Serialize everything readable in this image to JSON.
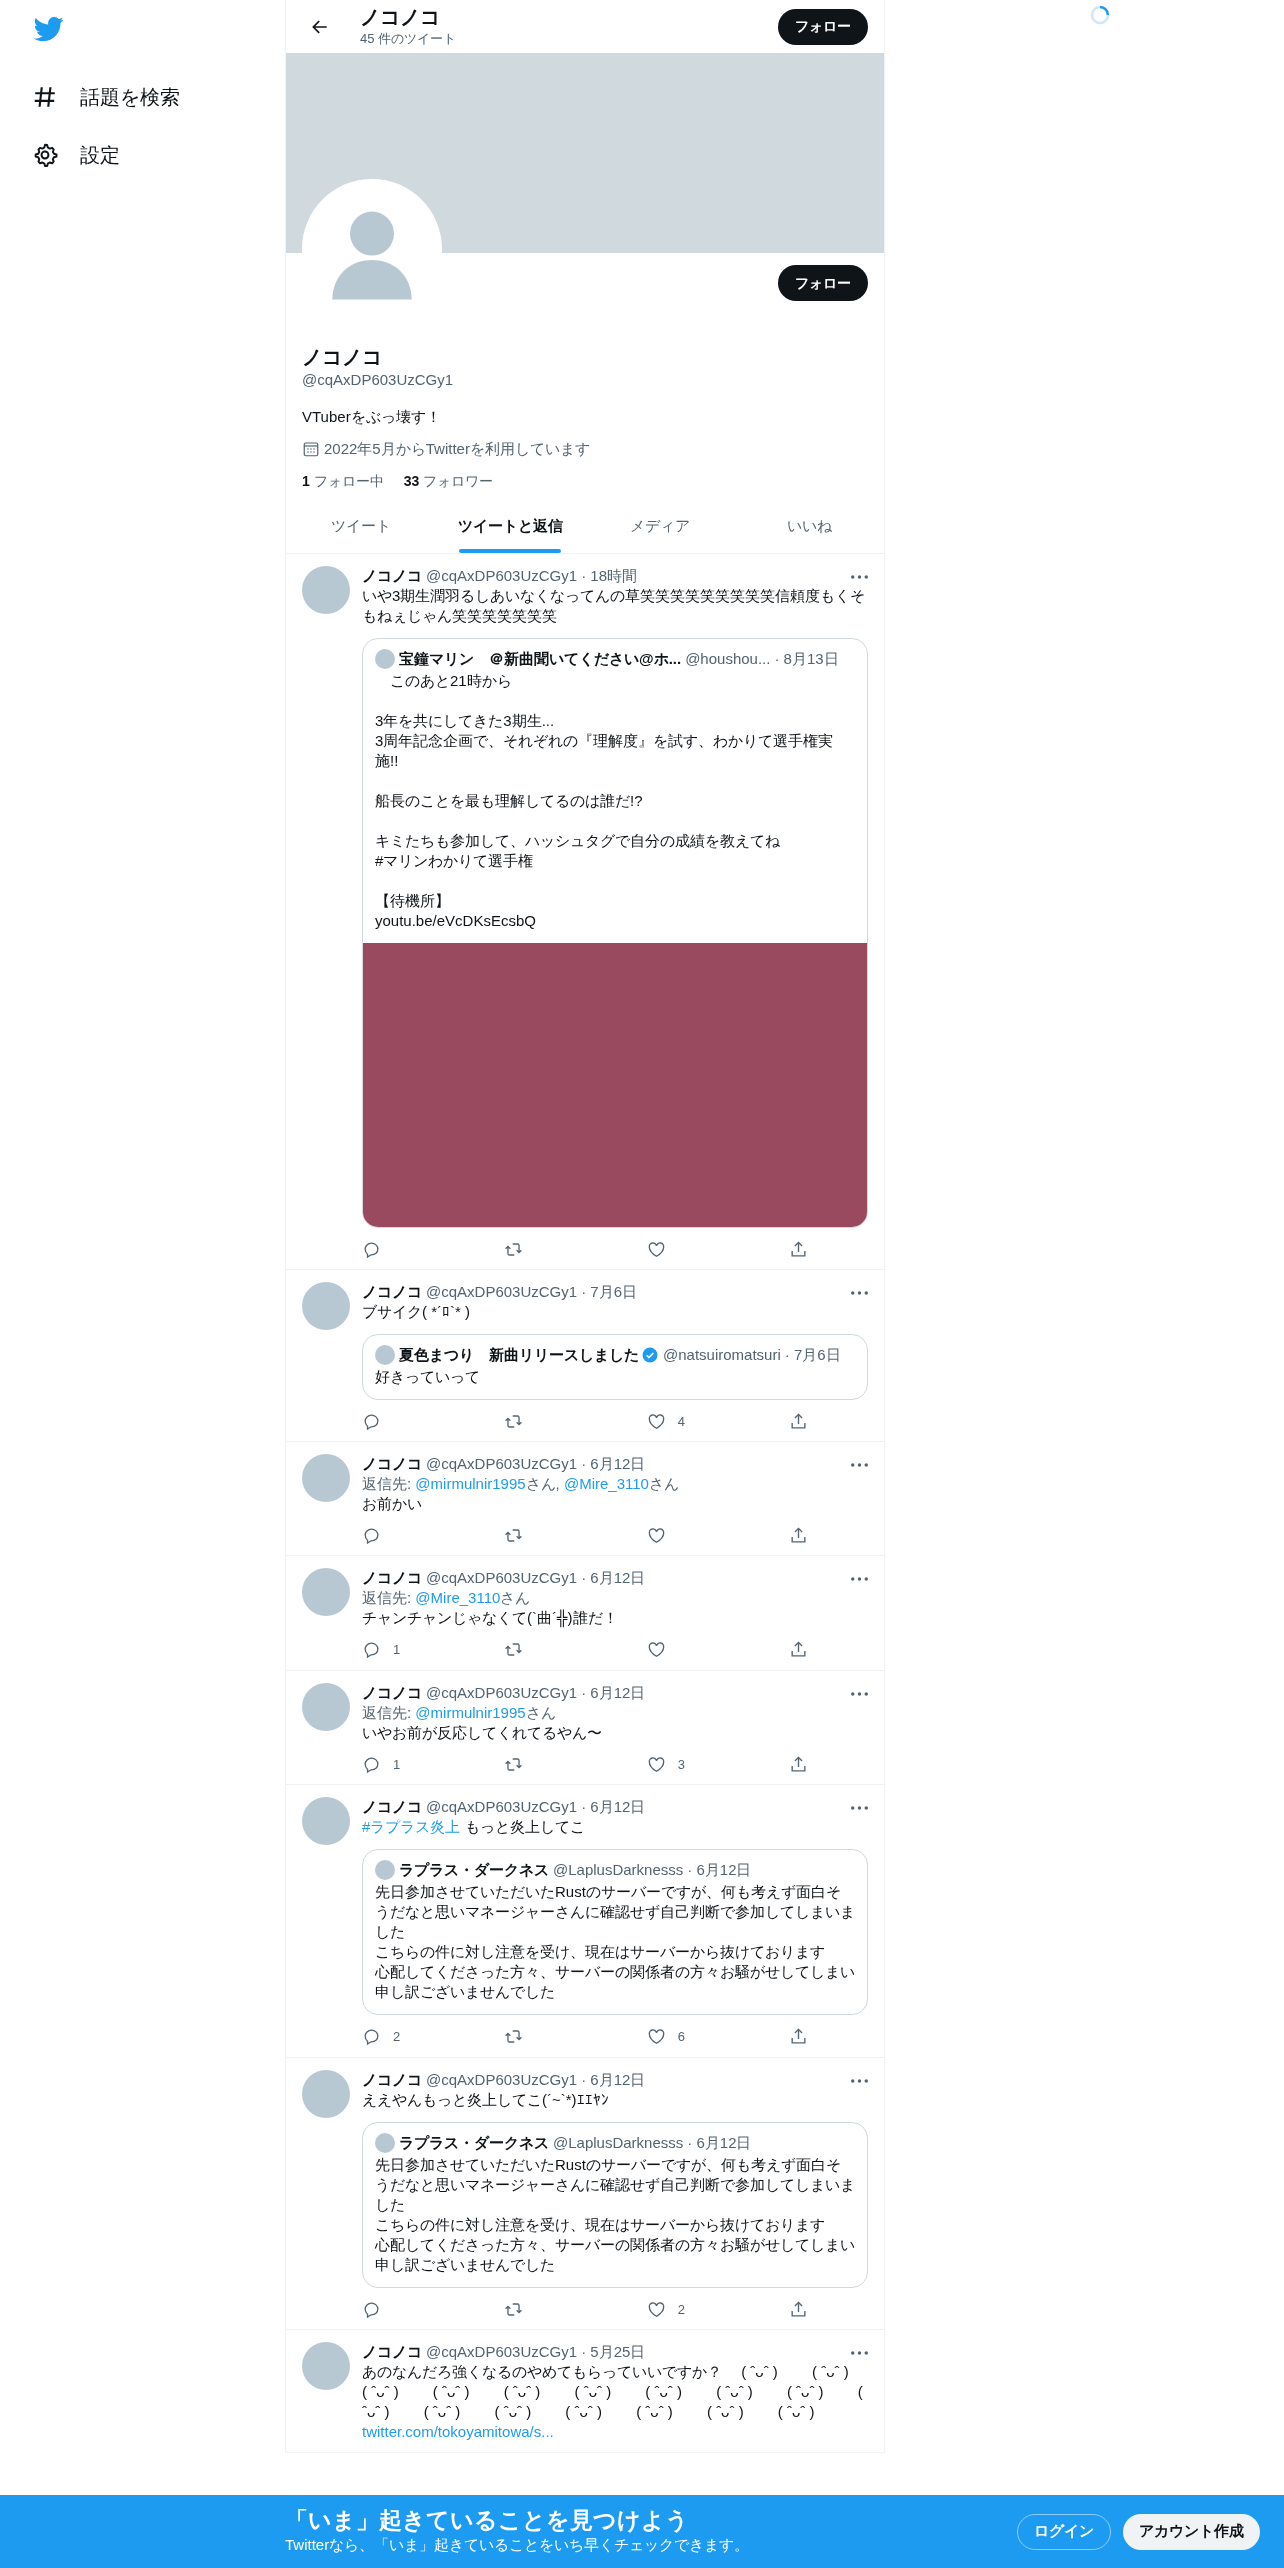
{
  "sidebar": {
    "items": [
      {
        "label": "話題を検索",
        "kind": "explore"
      },
      {
        "label": "設定",
        "kind": "settings"
      }
    ]
  },
  "header": {
    "title": "ノコノコ",
    "subtitle": "45 件のツイート",
    "follow_button": "フォロー"
  },
  "profile": {
    "follow_button": "フォロー",
    "name": "ノコノコ",
    "handle": "@cqAxDP603UzCGy1",
    "bio": "VTuberをぶっ壊す！",
    "joined": "2022年5月からTwitterを利用しています",
    "following_count": "1",
    "following_label": "フォロー中",
    "followers_count": "33",
    "followers_label": "フォロワー"
  },
  "tabs": [
    {
      "label": "ツイート",
      "selected": false
    },
    {
      "label": "ツイートと返信",
      "selected": true
    },
    {
      "label": "メディア",
      "selected": false
    },
    {
      "label": "いいね",
      "selected": false
    }
  ],
  "tweets": [
    {
      "name": "ノコノコ",
      "handle": "@cqAxDP603UzCGy1",
      "time": "· 18時間",
      "text": "いや3期生潤羽るしあいなくなってんの草笑笑笑笑笑笑笑笑笑信頼度もくそもねぇじゃん笑笑笑笑笑笑笑",
      "quote": {
        "name": "宝鐘マリン　＠新曲聞いてください@ホ...",
        "verified": false,
        "handle": "@houshou...",
        "time": "· 8月13日",
        "paragraphs": [
          [
            "　このあと21時から"
          ],
          [
            "3年を共にしてきた3期生...",
            "3周年記念企画で、それぞれの『理解度』を試す、わかりて選手権実施!!"
          ],
          [
            "船長のことを最も理解してるのは誰だ!?"
          ],
          [
            "キミたちも参加して、ハッシュタグで自分の成績を教えてね",
            "#マリンわかりて選手権"
          ],
          [
            "【待機所】",
            "youtu.be/eVcDKsEcsbQ"
          ]
        ],
        "has_media": true
      },
      "actions": [
        {
          "kind": "reply"
        },
        {
          "kind": "retweet"
        },
        {
          "kind": "like"
        },
        {
          "kind": "share"
        }
      ]
    },
    {
      "name": "ノコノコ",
      "handle": "@cqAxDP603UzCGy1",
      "time": "· 7月6日",
      "text": "ブサイク( *´ﾛ`* )",
      "quote": {
        "name": "夏色まつり　新曲リリースしました",
        "verified": true,
        "handle": "@natsuiromatsuri",
        "time": "· 7月6日",
        "paragraphs": [
          [
            "好きっていって"
          ]
        ],
        "has_media": false
      },
      "actions": [
        {
          "kind": "reply"
        },
        {
          "kind": "retweet"
        },
        {
          "kind": "like",
          "count": "4"
        },
        {
          "kind": "share"
        }
      ]
    },
    {
      "name": "ノコノコ",
      "handle": "@cqAxDP603UzCGy1",
      "time": "· 6月12日",
      "reply_prefix": "返信先:",
      "reply_to": [
        {
          "handle": "@mirmulnir1995",
          "suffix": "さん,"
        },
        {
          "handle": "@Mire_3110",
          "suffix": "さん"
        }
      ],
      "text": "お前かい",
      "actions": [
        {
          "kind": "reply"
        },
        {
          "kind": "retweet"
        },
        {
          "kind": "like"
        },
        {
          "kind": "share"
        }
      ]
    },
    {
      "name": "ノコノコ",
      "handle": "@cqAxDP603UzCGy1",
      "time": "· 6月12日",
      "reply_prefix": "返信先:",
      "reply_to": [
        {
          "handle": "@Mire_3110",
          "suffix": "さん"
        }
      ],
      "text": "チャンチャンじゃなくて(`曲´╬)誰だ！",
      "actions": [
        {
          "kind": "reply",
          "count": "1"
        },
        {
          "kind": "retweet"
        },
        {
          "kind": "like"
        },
        {
          "kind": "share"
        }
      ]
    },
    {
      "name": "ノコノコ",
      "handle": "@cqAxDP603UzCGy1",
      "time": "· 6月12日",
      "reply_prefix": "返信先:",
      "reply_to": [
        {
          "handle": "@mirmulnir1995",
          "suffix": "さん"
        }
      ],
      "text": "いやお前が反応してくれてるやん〜",
      "actions": [
        {
          "kind": "reply",
          "count": "1"
        },
        {
          "kind": "retweet"
        },
        {
          "kind": "like",
          "count": "3"
        },
        {
          "kind": "share"
        }
      ]
    },
    {
      "name": "ノコノコ",
      "handle": "@cqAxDP603UzCGy1",
      "time": "· 6月12日",
      "hashtag": "#ラプラス炎上",
      "text": "もっと炎上してこ",
      "quote": {
        "name": "ラプラス・ダークネス",
        "verified": false,
        "handle": "@LaplusDarknesss",
        "time": "· 6月12日",
        "paragraphs": [
          [
            "先日参加させていただいたRustのサーバーですが、何も考えず面白そうだなと思いマネージャーさんに確認せず自己判断で参加してしまいました",
            "こちらの件に対し注意を受け、現在はサーバーから抜けております",
            "心配してくださった方々、サーバーの関係者の方々お騒がせしてしまい申し訳ございませんでした"
          ]
        ],
        "has_media": false
      },
      "actions": [
        {
          "kind": "reply",
          "count": "2"
        },
        {
          "kind": "retweet"
        },
        {
          "kind": "like",
          "count": "6"
        },
        {
          "kind": "share"
        }
      ]
    },
    {
      "name": "ノコノコ",
      "handle": "@cqAxDP603UzCGy1",
      "time": "· 6月12日",
      "text": "ええやんもっと炎上してこ(´~`*)ｴｴﾔﾝ",
      "quote": {
        "name": "ラプラス・ダークネス",
        "verified": false,
        "handle": "@LaplusDarknesss",
        "time": "· 6月12日",
        "paragraphs": [
          [
            "先日参加させていただいたRustのサーバーですが、何も考えず面白そうだなと思いマネージャーさんに確認せず自己判断で参加してしまいました",
            "こちらの件に対し注意を受け、現在はサーバーから抜けております",
            "心配してくださった方々、サーバーの関係者の方々お騒がせしてしまい申し訳ございませんでした"
          ]
        ],
        "has_media": false
      },
      "actions": [
        {
          "kind": "reply"
        },
        {
          "kind": "retweet"
        },
        {
          "kind": "like",
          "count": "2"
        },
        {
          "kind": "share"
        }
      ]
    },
    {
      "name": "ノコノコ",
      "handle": "@cqAxDP603UzCGy1",
      "time": "· 5月25日",
      "text": "あのなんだろ強くなるのやめてもらっていいですか？　 ( ˆᴗˆ )　　 ( ˆᴗˆ )　　 ( ˆᴗˆ )　　 ( ˆᴗˆ )　　 ( ˆᴗˆ )　　 ( ˆᴗˆ )　　 ( ˆᴗˆ )　　 ( ˆᴗˆ )　　 ( ˆᴗˆ )　　 ( ˆᴗˆ )　　 ( ˆᴗˆ )　　 ( ˆᴗˆ )　　 ( ˆᴗˆ )　　 ( ˆᴗˆ )　　 ( ˆᴗˆ )　　 ( ˆᴗˆ )",
      "link": "twitter.com/tokoyamitowa/s..."
    }
  ],
  "banner": {
    "title": "「いま」起きていることを見つけよう",
    "subtitle": "Twitterなら、「いま」起きていることをいち早くチェックできます。",
    "login_button": "ログイン",
    "signup_button": "アカウント作成"
  }
}
